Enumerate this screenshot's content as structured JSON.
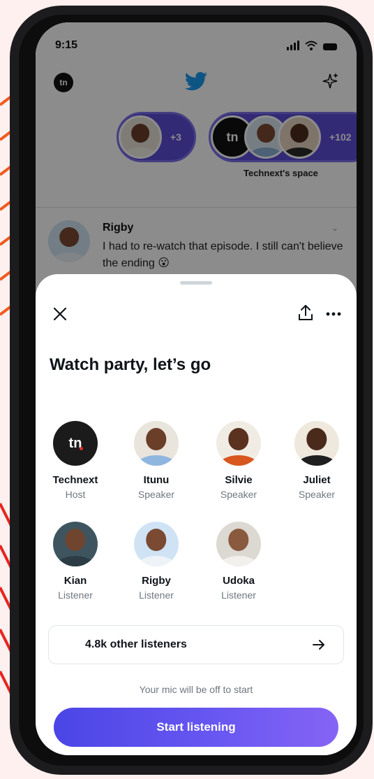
{
  "status_bar": {
    "time": "9:15"
  },
  "header": {
    "logo_text": "tn"
  },
  "spaces": {
    "pill_1_count": "+3",
    "pill_2_count": "+102",
    "pill_2_logo": "tn",
    "caption": "Technext's space"
  },
  "tweet": {
    "name": "Rigby",
    "text": "I had to re-watch that episode. I still can't believe the ending"
  },
  "sheet": {
    "title": "Watch party, let’s go",
    "people": [
      {
        "name": "Technext",
        "role": "Host",
        "logo": "tn"
      },
      {
        "name": "Itunu",
        "role": "Speaker"
      },
      {
        "name": "Silvie",
        "role": "Speaker"
      },
      {
        "name": "Juliet",
        "role": "Speaker"
      },
      {
        "name": "Kian",
        "role": "Listener"
      },
      {
        "name": "Rigby",
        "role": "Listener"
      },
      {
        "name": "Udoka",
        "role": "Listener"
      }
    ],
    "listeners_label": "4.8k other listeners",
    "mic_note": "Your mic will be off to start",
    "start_button": "Start listening"
  },
  "icons": {
    "close": "close-icon",
    "share": "share-icon",
    "more": "more-icon",
    "arrow": "arrow-right-icon",
    "bird": "twitter-bird-icon",
    "sparkle": "sparkle-icon"
  },
  "colors": {
    "accent": "#5b4dd6",
    "button_gradient_start": "#4b45e6",
    "button_gradient_end": "#8564f4",
    "background": "#fdf0ee"
  }
}
